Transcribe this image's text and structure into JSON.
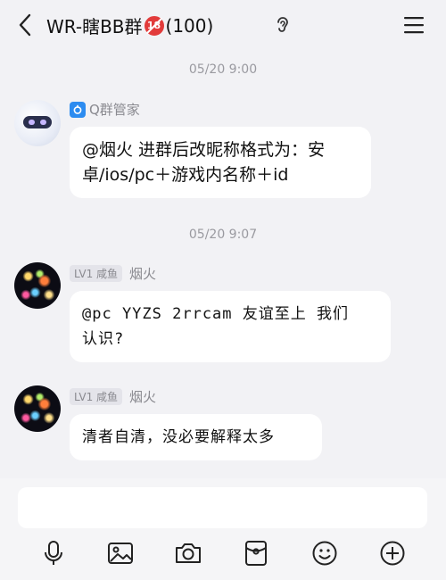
{
  "header": {
    "back_icon": "chevron-left-icon",
    "title_prefix": "WR-瞎BB群",
    "title_badge": "18",
    "title_count": "(100)",
    "ear_icon": "ear-icon",
    "menu_icon": "hamburger-menu-icon"
  },
  "messages": [
    {
      "timestamp": "05/20 9:00",
      "sender_name": "Q群管家",
      "text": "@烟火 进群后改昵称格式为：安卓/ios/pc＋游戏内名称＋id",
      "line1": "@烟火 进群后改昵称格式为：安",
      "line2": "卓/ios/pc＋游戏内名称＋id"
    },
    {
      "timestamp": "05/20 9:07",
      "level": "LV1 咸鱼",
      "sender_name": "烟火",
      "line1": "@pc YYZS 2rrcam 友谊至上 我们",
      "line2": "认识?"
    },
    {
      "level": "LV1 咸鱼",
      "sender_name": "烟火",
      "text": "清者自清，没必要解释太多"
    }
  ],
  "input": {
    "placeholder": ""
  },
  "toolbar": [
    "microphone-icon",
    "image-icon",
    "camera-icon",
    "red-packet-icon",
    "emoji-icon",
    "plus-icon"
  ],
  "colors": {
    "background": "#f2f2f5",
    "bubble": "#ffffff",
    "accent": "#2d8cf0",
    "badge": "#e23b3b"
  }
}
